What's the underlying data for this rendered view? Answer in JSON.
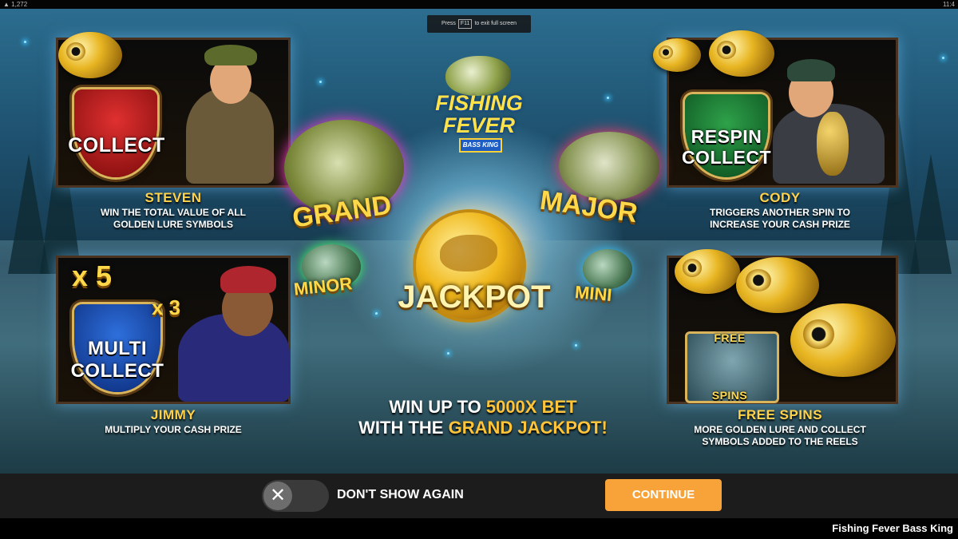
{
  "system_bar": {
    "left": "▲ 1,272",
    "right": "11:4"
  },
  "fullscreen_hint": {
    "prefix": "Press",
    "key": "F11",
    "suffix": "to exit full screen"
  },
  "logo": {
    "line1": "FISHING",
    "line2": "FEVER",
    "subtitle": "BASS KING"
  },
  "features": {
    "steven": {
      "badge": "COLLECT",
      "title": "STEVEN",
      "desc1": "WIN THE TOTAL VALUE OF ALL",
      "desc2": "GOLDEN LURE SYMBOLS"
    },
    "cody": {
      "badge1": "RESPIN",
      "badge2": "COLLECT",
      "title": "CODY",
      "desc1": "TRIGGERS ANOTHER SPIN TO",
      "desc2": "INCREASE YOUR CASH PRIZE"
    },
    "jimmy": {
      "badge1": "MULTI",
      "badge2": "COLLECT",
      "mult1": "x 5",
      "mult2": "x 3",
      "title": "JIMMY",
      "desc1": "MULTIPLY YOUR CASH PRIZE"
    },
    "free_spins": {
      "badge1": "FREE",
      "badge2": "SPINS",
      "title": "FREE SPINS",
      "desc1": "MORE GOLDEN LURE AND COLLECT",
      "desc2": "SYMBOLS ADDED TO THE REELS"
    }
  },
  "jackpots": {
    "grand": "GRAND",
    "major": "MAJOR",
    "minor": "MINOR",
    "mini": "MINI",
    "jackpot": "JACKPOT"
  },
  "win_line": {
    "l1a": "WIN UP TO ",
    "l1b": "5000X BET",
    "l2a": "WITH THE ",
    "l2b": "GRAND JACKPOT!"
  },
  "controls": {
    "toggle_icon": "✕",
    "dont_show": "DON'T SHOW AGAIN",
    "continue": "CONTINUE"
  },
  "footer_title": "Fishing Fever Bass King"
}
